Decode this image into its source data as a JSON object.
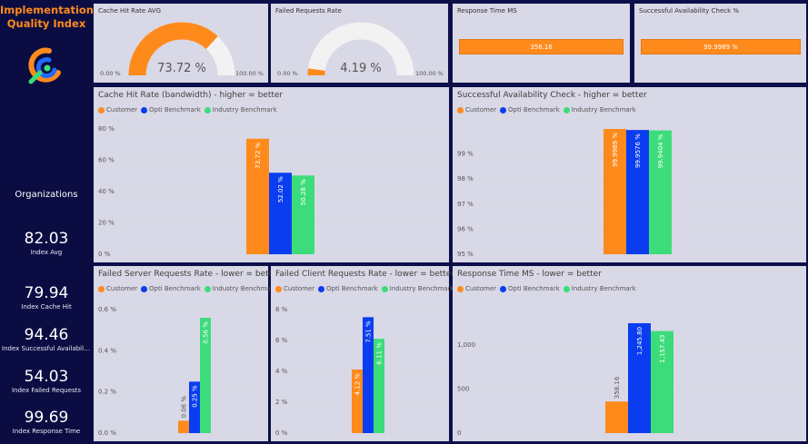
{
  "sidebar": {
    "title_line1": "Implementation",
    "title_line2": "Quality Index",
    "organizations_label": "Organizations",
    "kpis": [
      {
        "value": "82.03",
        "label": "Index Avg"
      },
      {
        "value": "79.94",
        "label": "Index Cache Hit"
      },
      {
        "value": "94.46",
        "label": "Index Successful Availability ..."
      },
      {
        "value": "54.03",
        "label": "Index Failed Requests"
      },
      {
        "value": "99.69",
        "label": "Index Response Time"
      }
    ],
    "logo_icon": "optimizely-logo-icon"
  },
  "colors": {
    "customer": "#ff8a1c",
    "opti": "#0a3df0",
    "industry": "#3ddc7a",
    "gauge_track": "#f2f2f2"
  },
  "cards": {
    "cache_gauge": {
      "title": "Cache Hit Rate AVG",
      "value_label": "73.72 %",
      "min_label": "0.00 %",
      "max_label": "100.00 %",
      "fraction": 0.7372
    },
    "failed_gauge": {
      "title": "Failed Requests Rate",
      "value_label": "4.19 %",
      "min_label": "0.00 %",
      "max_label": "100.00 %",
      "fraction": 0.0419
    },
    "response_card": {
      "title": "Response Time MS",
      "value": "358.16"
    },
    "availability_card": {
      "title": "Successful Availability Check %",
      "value": "99.9989 %"
    }
  },
  "legend": {
    "customer": "Customer",
    "opti": "Opti Benchmark",
    "industry": "Industry Benchmark"
  },
  "chart_data": [
    {
      "id": "cache",
      "type": "bar",
      "title": "Cache Hit Rate (bandwidth) - higher = better",
      "series": [
        {
          "name": "Customer",
          "values": [
            73.72
          ],
          "label": "73.72 %"
        },
        {
          "name": "Opti Benchmark",
          "values": [
            52.02
          ],
          "label": "52.02 %"
        },
        {
          "name": "Industry Benchmark",
          "values": [
            50.28
          ],
          "label": "50.28 %"
        }
      ],
      "ylim": [
        0,
        80
      ],
      "yticks": [
        0,
        20,
        40,
        60,
        80
      ],
      "ytick_labels": [
        "0 %",
        "20 %",
        "40 %",
        "60 %",
        "80 %"
      ]
    },
    {
      "id": "availability",
      "type": "bar",
      "title": "Successful Availability Check - higher = better",
      "series": [
        {
          "name": "Customer",
          "values": [
            99.9989
          ],
          "label": "99.9989 %"
        },
        {
          "name": "Opti Benchmark",
          "values": [
            99.9576
          ],
          "label": "99.9576 %"
        },
        {
          "name": "Industry Benchmark",
          "values": [
            99.9404
          ],
          "label": "99.9404 %"
        }
      ],
      "ylim": [
        95,
        100
      ],
      "yticks": [
        95,
        96,
        97,
        98,
        99
      ],
      "ytick_labels": [
        "95 %",
        "96 %",
        "97 %",
        "98 %",
        "99 %"
      ]
    },
    {
      "id": "server",
      "type": "bar",
      "title": "Failed Server Requests Rate - lower = better",
      "series": [
        {
          "name": "Customer",
          "values": [
            0.06
          ],
          "label": "0.06 %"
        },
        {
          "name": "Opti Benchmark",
          "values": [
            0.25
          ],
          "label": "0.25 %"
        },
        {
          "name": "Industry Benchmark",
          "values": [
            0.56
          ],
          "label": "0.56 %"
        }
      ],
      "ylim": [
        0,
        0.6
      ],
      "yticks": [
        0,
        0.2,
        0.4,
        0.6
      ],
      "ytick_labels": [
        "0.0 %",
        "0.2 %",
        "0.4 %",
        "0.6 %"
      ]
    },
    {
      "id": "client",
      "type": "bar",
      "title": "Failed Client Requests Rate - lower = better",
      "series": [
        {
          "name": "Customer",
          "values": [
            4.12
          ],
          "label": "4.12 %"
        },
        {
          "name": "Opti Benchmark",
          "values": [
            7.51
          ],
          "label": "7.51 %"
        },
        {
          "name": "Industry Benchmark",
          "values": [
            6.11
          ],
          "label": "6.11 %"
        }
      ],
      "ylim": [
        0,
        8
      ],
      "yticks": [
        0,
        2,
        4,
        6,
        8
      ],
      "ytick_labels": [
        "0 %",
        "2 %",
        "4 %",
        "6 %",
        "8 %"
      ]
    },
    {
      "id": "response",
      "type": "bar",
      "title": "Response Time MS - lower = better",
      "series": [
        {
          "name": "Customer",
          "values": [
            358.16
          ],
          "label": "358.16"
        },
        {
          "name": "Opti Benchmark",
          "values": [
            1245.8
          ],
          "label": "1,245.80"
        },
        {
          "name": "Industry Benchmark",
          "values": [
            1157.43
          ],
          "label": "1,157.43"
        }
      ],
      "ylim": [
        0,
        1400
      ],
      "yticks": [
        0,
        500,
        1000
      ],
      "ytick_labels": [
        "0",
        "500",
        "1,000"
      ]
    }
  ]
}
